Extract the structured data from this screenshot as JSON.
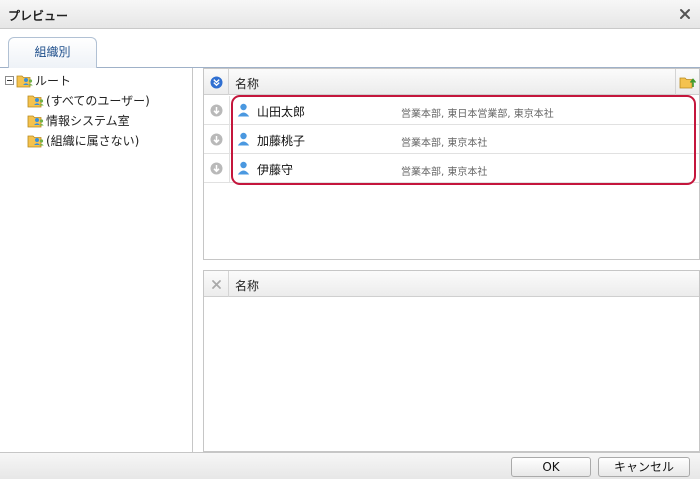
{
  "window": {
    "title": "プレビュー"
  },
  "tabs": [
    {
      "label": "組織別"
    }
  ],
  "tree": {
    "root": {
      "label": "ルート"
    },
    "children": [
      {
        "label": "(すべてのユーザー)"
      },
      {
        "label": "情報システム室"
      },
      {
        "label": "(組織に属さない)"
      }
    ]
  },
  "available_list": {
    "header": "名称",
    "rows": [
      {
        "name": "山田太郎",
        "org": "営業本部, 東日本営業部, 東京本社"
      },
      {
        "name": "加藤桃子",
        "org": "営業本部, 東京本社"
      },
      {
        "name": "伊藤守",
        "org": "営業本部, 東京本社"
      }
    ]
  },
  "selected_list": {
    "header": "名称",
    "rows": []
  },
  "footer": {
    "ok_label": "OK",
    "cancel_label": "キャンセル"
  },
  "colors": {
    "highlight": "#c4163c",
    "accent": "#2f6fd1",
    "tab_text": "#20508c"
  }
}
